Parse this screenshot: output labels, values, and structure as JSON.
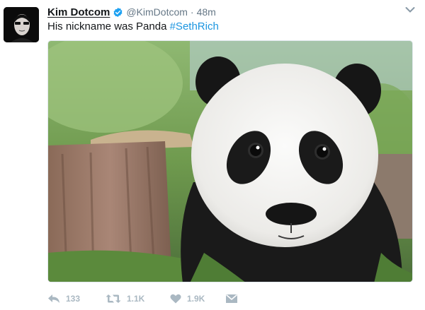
{
  "tweet": {
    "author_name": "Kim Dotcom",
    "handle": "@KimDotcom",
    "separator": "·",
    "time": "48m",
    "text_before": "His nickname was Panda ",
    "hashtag": "#SethRich",
    "replies": "133",
    "retweets": "1.1K",
    "likes": "1.9K"
  },
  "icons": {
    "verified": "verified-badge-icon",
    "menu": "chevron-down-icon",
    "reply": "reply-icon",
    "retweet": "retweet-icon",
    "like": "heart-icon",
    "message": "direct-message-icon"
  },
  "colors": {
    "text": "#14171a",
    "muted": "#657786",
    "link": "#1b95e0",
    "action": "#aab8c2"
  }
}
